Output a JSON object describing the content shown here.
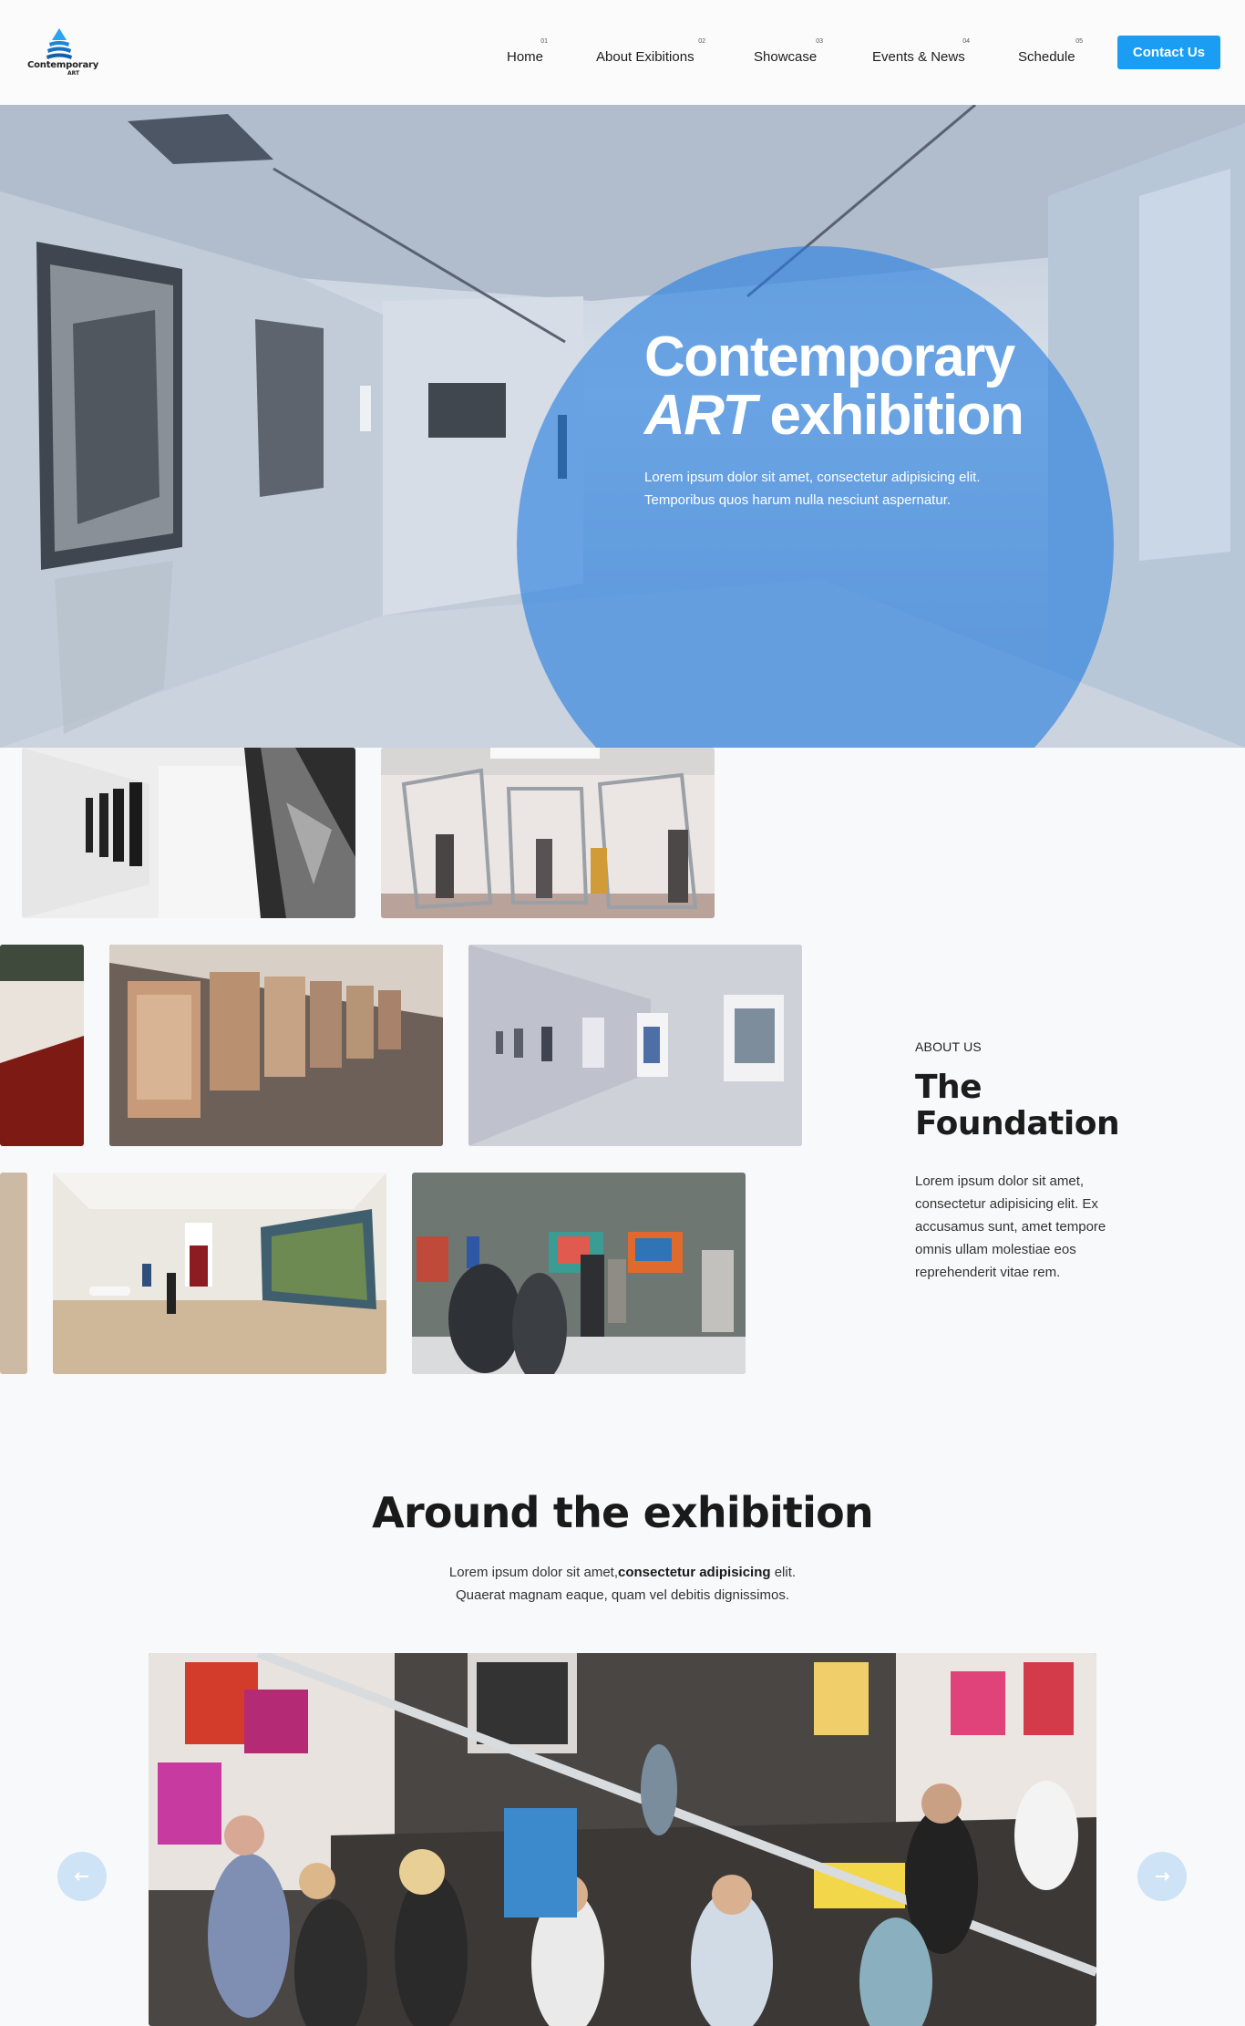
{
  "header": {
    "logo": {
      "line1": "Contemporary",
      "line2": "ART"
    },
    "nav": [
      {
        "num": "01",
        "label": "Home"
      },
      {
        "num": "02",
        "label": "About Exibitions"
      },
      {
        "num": "03",
        "label": "Showcase"
      },
      {
        "num": "04",
        "label": "Events & News"
      },
      {
        "num": "05",
        "label": "Schedule"
      }
    ],
    "contact_label": "Contact Us",
    "accent": "#1b9df3"
  },
  "hero": {
    "title_line1": "Contemporary",
    "title_line2_italic": "ART",
    "title_line2_rest": "exhibition",
    "description": "Lorem ipsum dolor sit amet, consectetur adipisicing elit. Temporibus quos harum nulla nesciunt aspernatur.",
    "circle_color": "#257ee0"
  },
  "about": {
    "eyebrow": "ABOUT US",
    "title": "The Foundation",
    "text": "Lorem ipsum dolor sit amet, consectetur adipisicing elit. Ex accusamus sunt, amet tempore omnis ullam molestiae eos reprehenderit vitae rem."
  },
  "around": {
    "title": "Around the exhibition",
    "desc_pre": "Lorem ipsum dolor sit amet,",
    "desc_bold": "consectetur adipisicing",
    "desc_post": " elit.",
    "desc_line2": "Quaerat magnam eaque, quam vel debitis dignissimos.",
    "prev_icon": "arrow-left-icon",
    "next_icon": "arrow-right-icon"
  }
}
